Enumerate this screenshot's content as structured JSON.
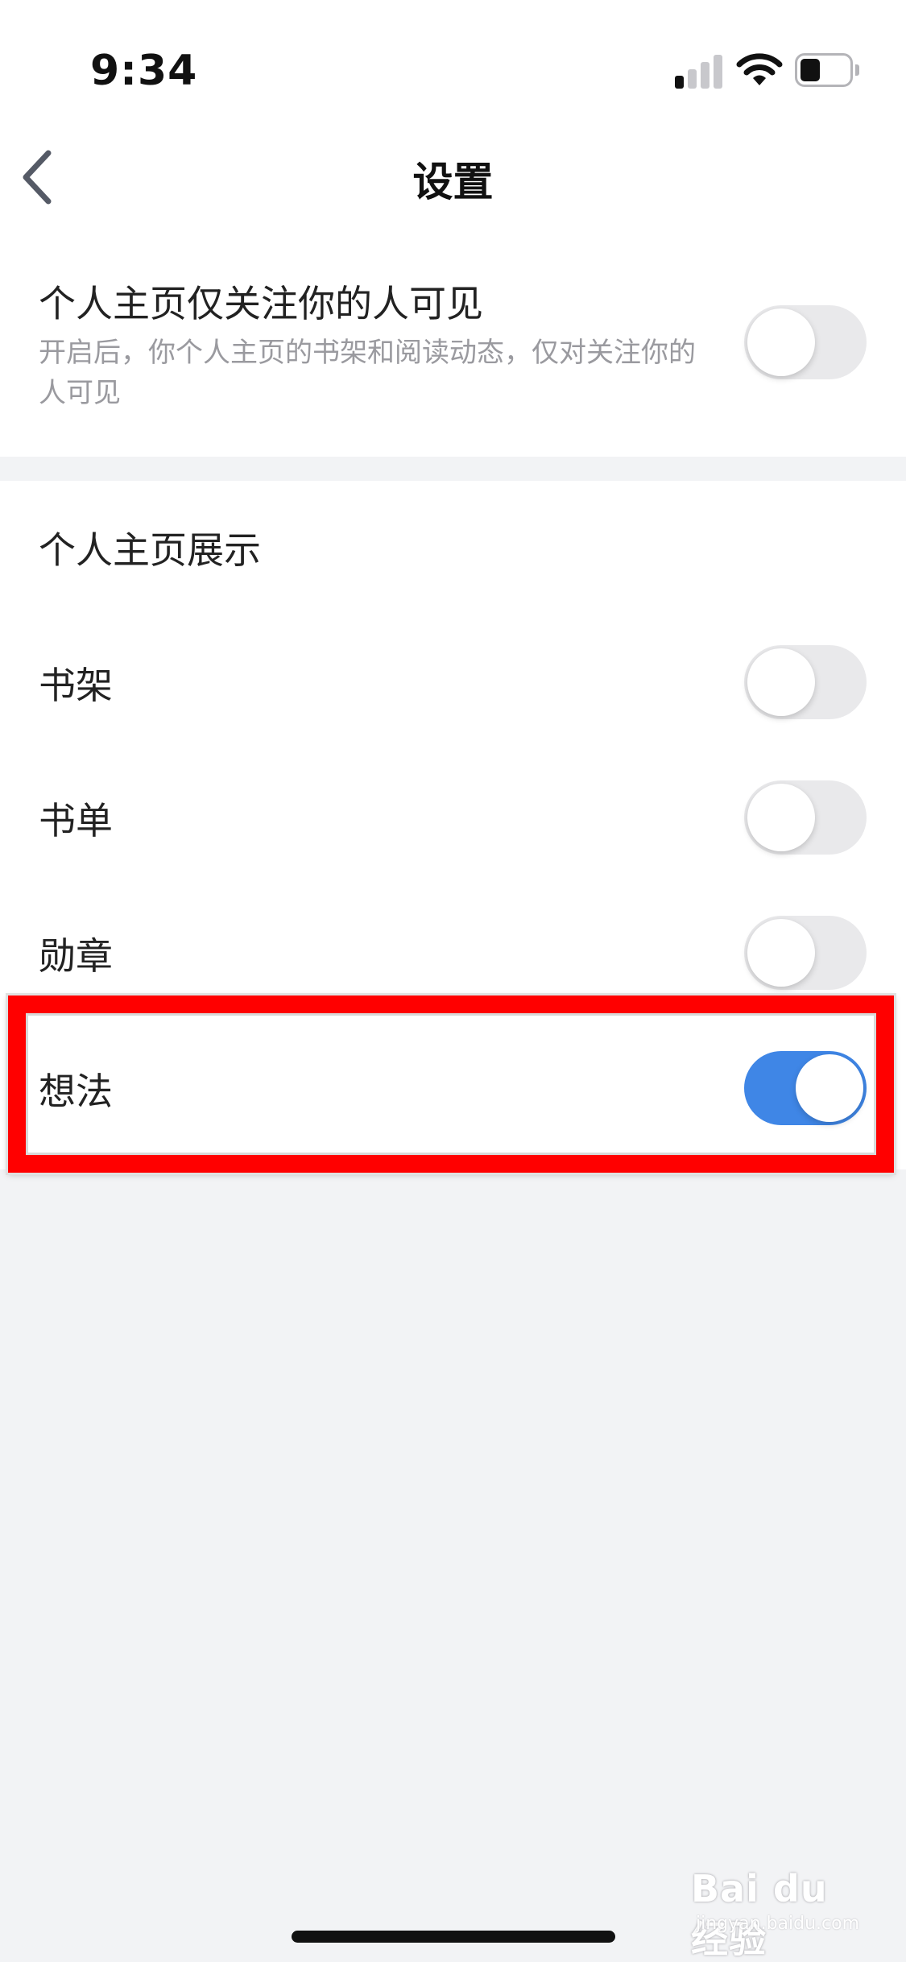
{
  "status_bar": {
    "time": "9:34",
    "signal_icon": "cellular-signal-icon",
    "wifi_icon": "wifi-icon",
    "battery_icon": "battery-icon",
    "battery_level": 0.35
  },
  "nav": {
    "title": "设置",
    "back_icon": "chevron-left-icon"
  },
  "privacy": {
    "title": "个人主页仅关注你的人可见",
    "description": "开启后，你个人主页的书架和阅读动态，仅对关注你的人可见",
    "enabled": false
  },
  "display": {
    "header": "个人主页展示",
    "items": [
      {
        "label": "书架",
        "enabled": false
      },
      {
        "label": "书单",
        "enabled": false
      },
      {
        "label": "勋章",
        "enabled": false
      },
      {
        "label": "想法",
        "enabled": true
      }
    ]
  },
  "colors": {
    "accent": "#3f86e6",
    "highlight": "#ff0000",
    "background": "#f2f3f5"
  },
  "watermark": {
    "brand": "Bai du 经验",
    "sub": "jingyan.baidu.com"
  }
}
